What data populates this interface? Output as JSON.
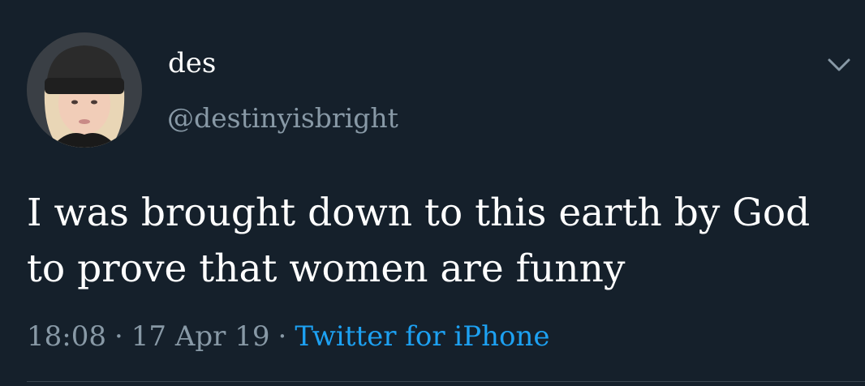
{
  "user": {
    "display_name": "des",
    "handle": "@destinyisbright",
    "avatar_icon": "profile-photo-beanie"
  },
  "tweet": {
    "lines": [
      "I was brought down to this earth by God",
      "to prove that women are funny"
    ]
  },
  "meta": {
    "time": "18:08",
    "separator": "·",
    "date": "17 Apr 19",
    "source": "Twitter for iPhone"
  },
  "icons": {
    "menu": "chevron-down-icon"
  },
  "colors": {
    "background": "#15202b",
    "text": "#ffffff",
    "secondary": "#8899a6",
    "link": "#1da1f2"
  }
}
